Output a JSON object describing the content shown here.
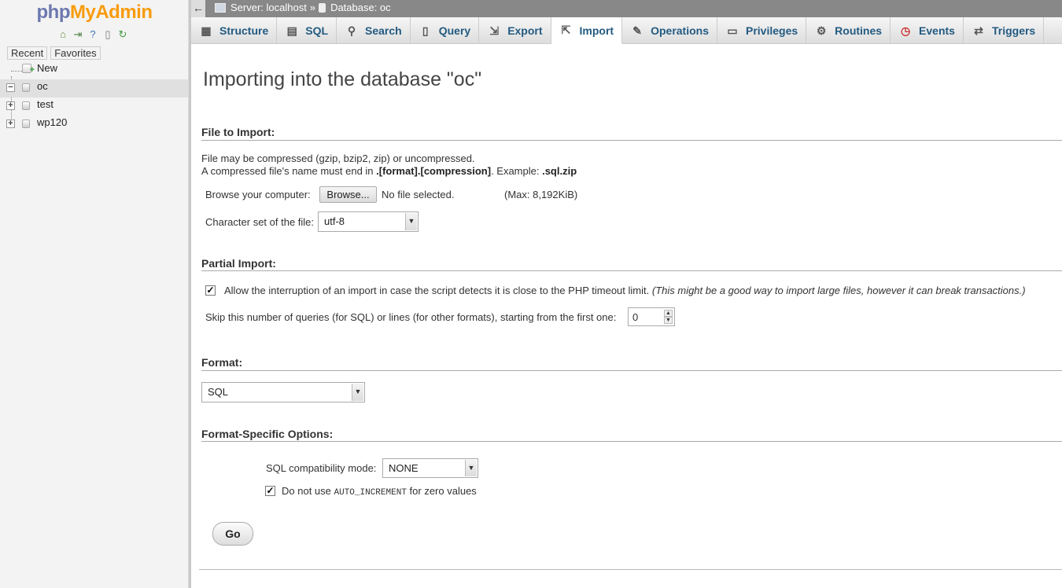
{
  "sidebar": {
    "logo_php": "php",
    "logo_my": "MyAdmin",
    "icons": [
      "home-icon",
      "logout-icon",
      "help-icon",
      "docs-icon",
      "reload-icon"
    ],
    "tabs": [
      "Recent",
      "Favorites"
    ],
    "tree": {
      "new_label": "New",
      "databases": [
        {
          "name": "oc",
          "expanded": true,
          "selected": true
        },
        {
          "name": "test",
          "expanded": false,
          "selected": false
        },
        {
          "name": "wp120",
          "expanded": false,
          "selected": false
        }
      ]
    }
  },
  "topbar": {
    "back": "←",
    "server": "Server: localhost",
    "separator": "»",
    "database": "Database: oc"
  },
  "tabs": [
    {
      "label": "Structure",
      "icon": "structure-icon"
    },
    {
      "label": "SQL",
      "icon": "sql-icon"
    },
    {
      "label": "Search",
      "icon": "search-icon"
    },
    {
      "label": "Query",
      "icon": "query-icon"
    },
    {
      "label": "Export",
      "icon": "export-icon"
    },
    {
      "label": "Import",
      "icon": "import-icon",
      "active": true
    },
    {
      "label": "Operations",
      "icon": "operations-icon"
    },
    {
      "label": "Privileges",
      "icon": "privileges-icon"
    },
    {
      "label": "Routines",
      "icon": "routines-icon"
    },
    {
      "label": "Events",
      "icon": "events-icon"
    },
    {
      "label": "Triggers",
      "icon": "triggers-icon"
    }
  ],
  "main": {
    "title": "Importing into the database \"oc\"",
    "file_section": {
      "legend": "File to Import:",
      "note1": "File may be compressed (gzip, bzip2, zip) or uncompressed.",
      "note2_prefix": "A compressed file's name must end in ",
      "note2_bold": ".[format].[compression]",
      "note2_mid": ". Example: ",
      "note2_example": ".sql.zip",
      "browse_label": "Browse your computer:",
      "browse_button": "Browse...",
      "file_status": "No file selected.",
      "max_size": "(Max: 8,192KiB)",
      "charset_label": "Character set of the file:",
      "charset_value": "utf-8"
    },
    "partial_section": {
      "legend": "Partial Import:",
      "allow_interrupt_checked": true,
      "allow_interrupt_label": "Allow the interruption of an import in case the script detects it is close to the PHP timeout limit.",
      "allow_interrupt_note": "(This might be a good way to import large files, however it can break transactions.)",
      "skip_label": "Skip this number of queries (for SQL) or lines (for other formats), starting from the first one:",
      "skip_value": "0"
    },
    "format_section": {
      "legend": "Format:",
      "format_value": "SQL"
    },
    "format_options": {
      "legend": "Format-Specific Options:",
      "compat_label": "SQL compatibility mode:",
      "compat_value": "NONE",
      "no_auto_increment_checked": true,
      "no_auto_prefix": "Do not use ",
      "no_auto_code": "AUTO_INCREMENT",
      "no_auto_suffix": " for zero values"
    },
    "go_button": "Go"
  },
  "colors": {
    "logo_php": "#6c78af",
    "logo_my": "#f89c0e",
    "tab_text": "#235a81",
    "topbar_bg": "#888888"
  }
}
